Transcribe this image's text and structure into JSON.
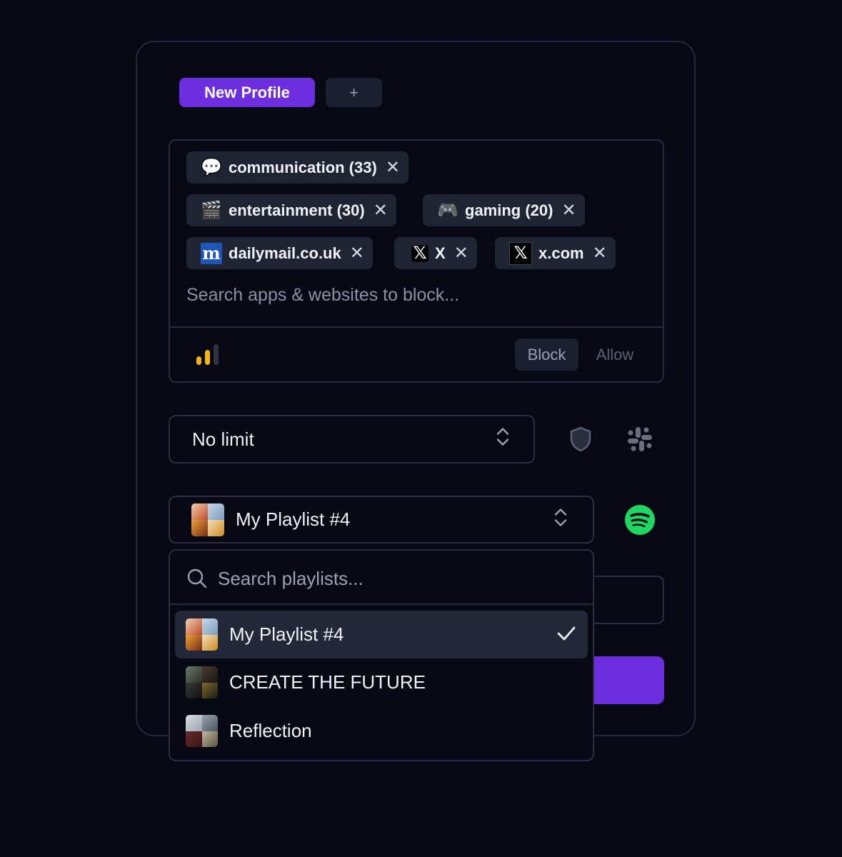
{
  "profile_tabs": {
    "active_label": "New Profile",
    "add_label": "+"
  },
  "block_list": {
    "chips": [
      {
        "label": "communication (33)",
        "icon": "speech-bubble-icon",
        "glyph": "💬"
      },
      {
        "label": "entertainment (30)",
        "icon": "clapper-board-icon",
        "glyph": "🎬"
      },
      {
        "label": "gaming (20)",
        "icon": "game-controller-icon",
        "glyph": "🎮"
      },
      {
        "label": "dailymail.co.uk",
        "icon": "dailymail-logo-icon",
        "glyph": "m"
      },
      {
        "label": "X",
        "icon": "x-logo-icon",
        "glyph": "𝕏"
      },
      {
        "label": "x.com",
        "icon": "x-logo-icon",
        "glyph": "𝕏"
      }
    ],
    "remove_glyph": "✕",
    "search_placeholder": "Search apps & websites to block...",
    "mode_options": [
      "Block",
      "Allow"
    ],
    "selected_mode": "Block",
    "strength_bars_filled": 2,
    "strength_bars_total": 3
  },
  "limit_select": {
    "value": "No limit"
  },
  "playlist_select": {
    "value": "My Playlist #4"
  },
  "playlist_dropdown": {
    "search_placeholder": "Search playlists...",
    "items": [
      {
        "label": "My Playlist #4",
        "selected": true
      },
      {
        "label": "CREATE THE FUTURE",
        "selected": false
      },
      {
        "label": "Reflection",
        "selected": false
      }
    ]
  },
  "colors": {
    "accent": "#6d2ee0",
    "background": "#060914",
    "chip": "#1f2433",
    "spotify_green": "#1ed760",
    "strength_yellow": "#f5b50a"
  }
}
